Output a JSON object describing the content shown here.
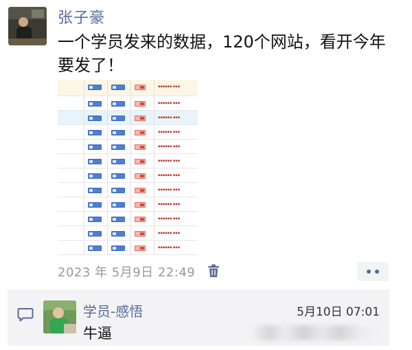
{
  "post": {
    "author_name": "张子豪",
    "text": "一个学员发来的数据，120个网站，看开今年要发了！",
    "timestamp": "2023 年 5月9日  22:49",
    "icons": {
      "delete": "trash-icon",
      "more": "more-dots-icon"
    }
  },
  "comment": {
    "icon": "comment-icon",
    "commenter_name": "学员-感悟",
    "time": "5月10日 07:01",
    "text": "牛逼"
  },
  "colors": {
    "name_link": "#576b95",
    "timestamp": "#9a9a9a",
    "comment_bg": "#f3f3f5"
  }
}
